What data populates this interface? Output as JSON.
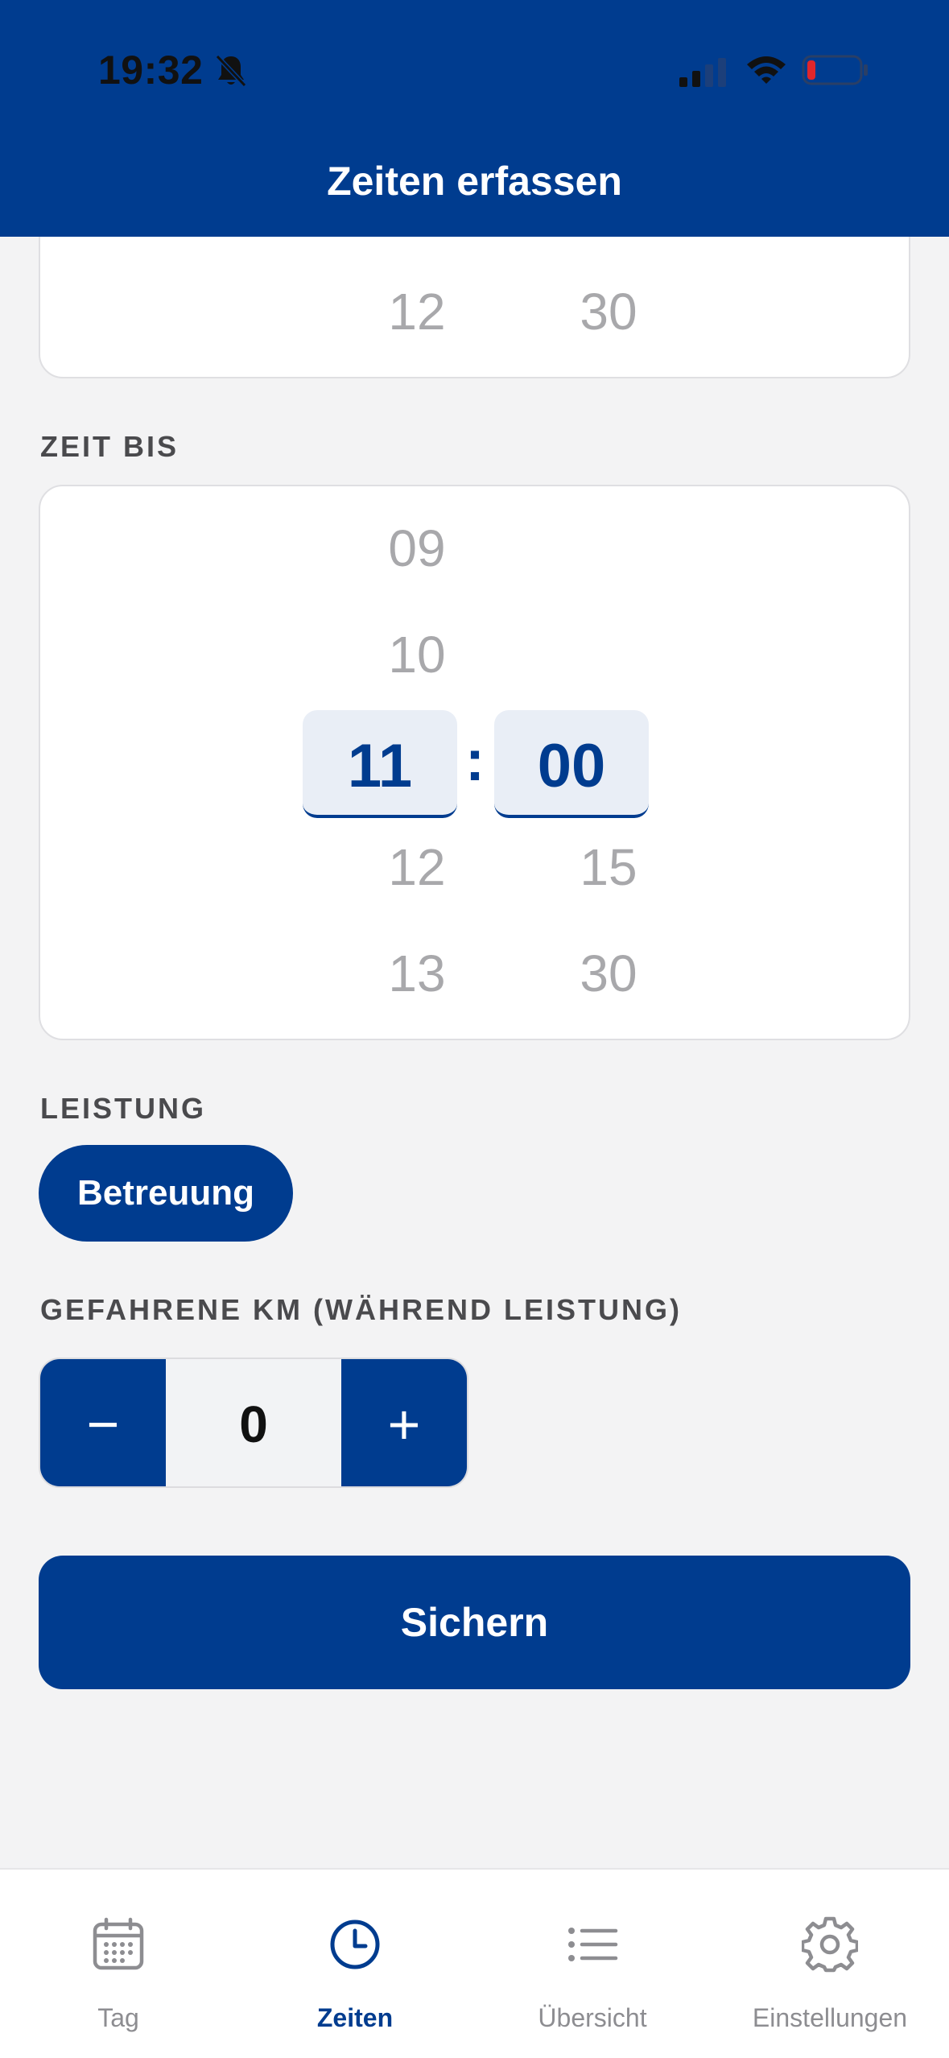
{
  "status_bar": {
    "time": "19:32"
  },
  "header": {
    "title": "Zeiten erfassen"
  },
  "zeit_von_partial": {
    "hour_below": "12",
    "minute_below": "30"
  },
  "zeit_bis": {
    "label": "ZEIT BIS",
    "hours": {
      "above2": "09",
      "above1": "10",
      "selected": "11",
      "below1": "12",
      "below2": "13"
    },
    "minutes": {
      "selected": "00",
      "below1": "15",
      "below2": "30"
    },
    "separator": ":"
  },
  "leistung": {
    "label": "LEISTUNG",
    "option": "Betreuung"
  },
  "km": {
    "label": "GEFAHRENE KM (WÄHREND LEISTUNG)",
    "value": "0",
    "minus": "−",
    "plus": "+"
  },
  "save": {
    "label": "Sichern"
  },
  "tabs": [
    {
      "label": "Tag",
      "icon": "calendar-icon",
      "active": false
    },
    {
      "label": "Zeiten",
      "icon": "clock-icon",
      "active": true
    },
    {
      "label": "Übersicht",
      "icon": "list-icon",
      "active": false
    },
    {
      "label": "Einstellungen",
      "icon": "gear-icon",
      "active": false
    }
  ],
  "colors": {
    "primary": "#003c8f",
    "background": "#f3f3f4",
    "muted": "#a8a8ab"
  }
}
